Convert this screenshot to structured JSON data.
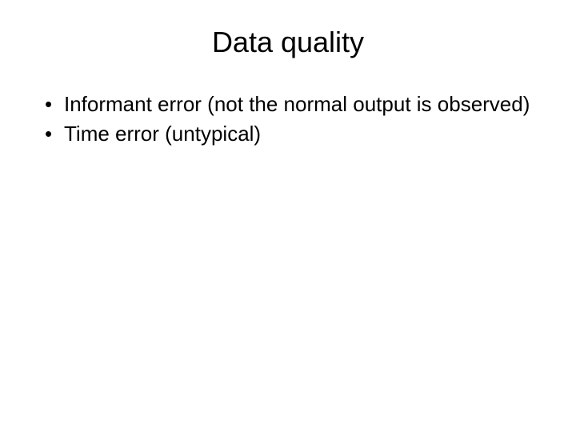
{
  "slide": {
    "title": "Data quality",
    "bullets": [
      "Informant error (not the normal output is observed)",
      "Time error (untypical)"
    ]
  }
}
